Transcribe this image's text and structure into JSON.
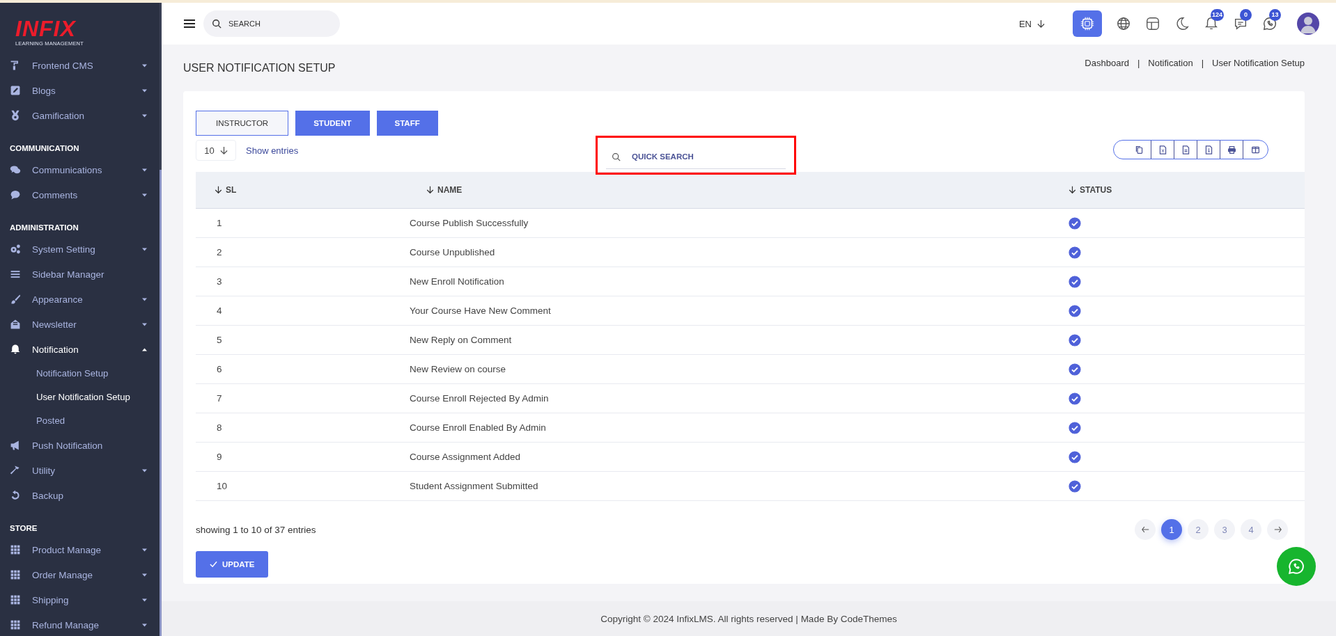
{
  "topbar": {
    "search": {
      "placeholder": "SEARCH"
    },
    "language": "EN",
    "badges": [
      {
        "count": "124"
      },
      {
        "count": "0"
      },
      {
        "count": "13"
      }
    ]
  },
  "sidebar": {
    "logo": {
      "wordmark": "INFIX",
      "tagline": "LEARNING MANAGEMENT"
    },
    "sections": [
      {
        "items": [
          {
            "label": "Frontend CMS",
            "kind": "dropdown",
            "selected": false,
            "expanded": false
          },
          {
            "label": "Blogs",
            "kind": "dropdown",
            "selected": false,
            "expanded": false
          },
          {
            "label": "Gamification",
            "kind": "dropdown",
            "selected": false,
            "expanded": false
          }
        ]
      },
      {
        "title": "COMMUNICATION",
        "items": [
          {
            "label": "Communications",
            "kind": "dropdown",
            "selected": false,
            "expanded": false
          },
          {
            "label": "Comments",
            "kind": "dropdown",
            "selected": false,
            "expanded": false
          }
        ]
      },
      {
        "title": "ADMINISTRATION",
        "items": [
          {
            "label": "System Setting",
            "kind": "dropdown",
            "selected": false,
            "expanded": false
          },
          {
            "label": "Sidebar Manager",
            "kind": "link",
            "selected": false
          },
          {
            "label": "Appearance",
            "kind": "dropdown",
            "selected": false,
            "expanded": false
          },
          {
            "label": "Newsletter",
            "kind": "dropdown",
            "selected": false,
            "expanded": false
          },
          {
            "label": "Notification",
            "kind": "dropdown",
            "selected": true,
            "expanded": true,
            "children": [
              {
                "label": "Notification Setup",
                "selected": false
              },
              {
                "label": "User Notification Setup",
                "selected": true
              },
              {
                "label": "Posted",
                "selected": false
              }
            ]
          },
          {
            "label": "Push Notification",
            "kind": "link",
            "selected": false
          },
          {
            "label": "Utility",
            "kind": "dropdown",
            "selected": false,
            "expanded": false
          },
          {
            "label": "Backup",
            "kind": "link",
            "selected": false
          }
        ]
      },
      {
        "title": "STORE",
        "items": [
          {
            "label": "Product Manage",
            "kind": "dropdown",
            "selected": false,
            "expanded": false
          },
          {
            "label": "Order Manage",
            "kind": "dropdown",
            "selected": false,
            "expanded": false
          },
          {
            "label": "Shipping",
            "kind": "dropdown",
            "selected": false,
            "expanded": false
          },
          {
            "label": "Refund Manage",
            "kind": "dropdown",
            "selected": false,
            "expanded": false
          }
        ]
      }
    ]
  },
  "page": {
    "title": "USER NOTIFICATION SETUP",
    "breadcrumb": {
      "separator": "|",
      "items": [
        "Dashboard",
        "Notification",
        "User Notification Setup"
      ]
    }
  },
  "tabs": [
    {
      "label": "INSTRUCTOR",
      "selected": true
    },
    {
      "label": "STUDENT",
      "selected": false
    },
    {
      "label": "STAFF",
      "selected": false
    }
  ],
  "entries": {
    "value": "10",
    "label": "Show entries"
  },
  "quick_search": {
    "placeholder": "QUICK SEARCH",
    "highlighted": true
  },
  "table": {
    "columns": [
      "SL",
      "NAME",
      "STATUS"
    ],
    "rows": [
      {
        "sl": "1",
        "name": "Course Publish Successfully",
        "active": true
      },
      {
        "sl": "2",
        "name": "Course Unpublished",
        "active": true
      },
      {
        "sl": "3",
        "name": "New Enroll Notification",
        "active": true
      },
      {
        "sl": "4",
        "name": "Your Course Have New Comment",
        "active": true
      },
      {
        "sl": "5",
        "name": "New Reply on Comment",
        "active": true
      },
      {
        "sl": "6",
        "name": "New Review on course",
        "active": true
      },
      {
        "sl": "7",
        "name": "Course Enroll Rejected By Admin",
        "active": true
      },
      {
        "sl": "8",
        "name": "Course Enroll Enabled By Admin",
        "active": true
      },
      {
        "sl": "9",
        "name": "Course Assignment Added",
        "active": true
      },
      {
        "sl": "10",
        "name": "Student Assignment Submitted",
        "active": true
      }
    ]
  },
  "summary": "showing 1 to 10 of 37 entries",
  "pagination": [
    {
      "label": "1",
      "selected": true
    },
    {
      "label": "2",
      "selected": false
    },
    {
      "label": "3",
      "selected": false
    },
    {
      "label": "4",
      "selected": false
    }
  ],
  "update_button": {
    "label": "UPDATE"
  },
  "footer": "Copyright © 2024 InfixLMS. All rights reserved | Made By CodeThemes"
}
